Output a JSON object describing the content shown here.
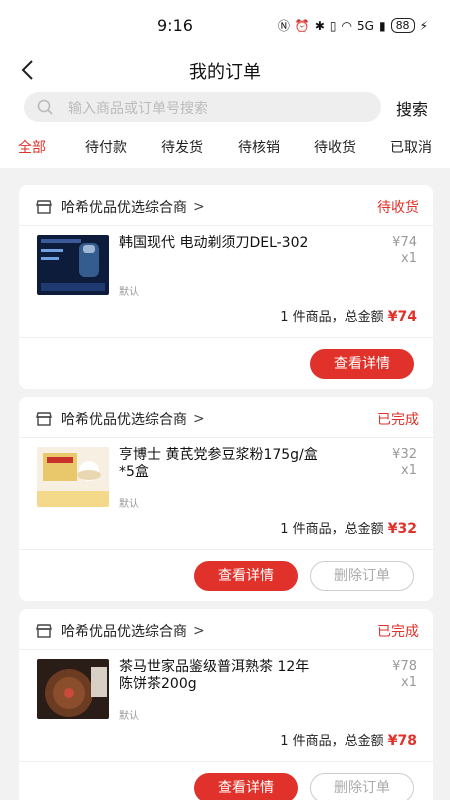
{
  "status_bar": {
    "time": "9:16",
    "network": "5G",
    "battery": "88"
  },
  "header": {
    "title": "我的订单"
  },
  "search": {
    "placeholder": "输入商品或订单号搜索",
    "button_label": "搜索"
  },
  "tabs": [
    {
      "label": "全部",
      "active": true
    },
    {
      "label": "待付款",
      "active": false
    },
    {
      "label": "待发货",
      "active": false
    },
    {
      "label": "待核销",
      "active": false
    },
    {
      "label": "待收货",
      "active": false
    },
    {
      "label": "已取消",
      "active": false
    }
  ],
  "colors": {
    "accent": "#e0322a",
    "muted": "#999999"
  },
  "orders": [
    {
      "shop": "哈希优品优选综合商",
      "status": "待收货",
      "product": "韩国现代 电动剃须刀DEL-302",
      "spec": "默认",
      "price": "¥74",
      "qty": "x1",
      "summary_prefix": "1 件商品，总金额",
      "total": "¥74",
      "detail_label": "查看详情"
    },
    {
      "shop": "哈希优品优选综合商",
      "status": "已完成",
      "product": "亨博士 黄芪党参豆浆粉175g/盒*5盒",
      "spec": "默认",
      "price": "¥32",
      "qty": "x1",
      "summary_prefix": "1 件商品，总金额",
      "total": "¥32",
      "detail_label": "查看详情",
      "delete_label": "删除订单"
    },
    {
      "shop": "哈希优品优选综合商",
      "status": "已完成",
      "product": "茶马世家品鉴级普洱熟茶 12年陈饼茶200g",
      "spec": "默认",
      "price": "¥78",
      "qty": "x1",
      "summary_prefix": "1 件商品，总金额",
      "total": "¥78",
      "detail_label": "查看详情",
      "delete_label": "删除订单"
    }
  ]
}
